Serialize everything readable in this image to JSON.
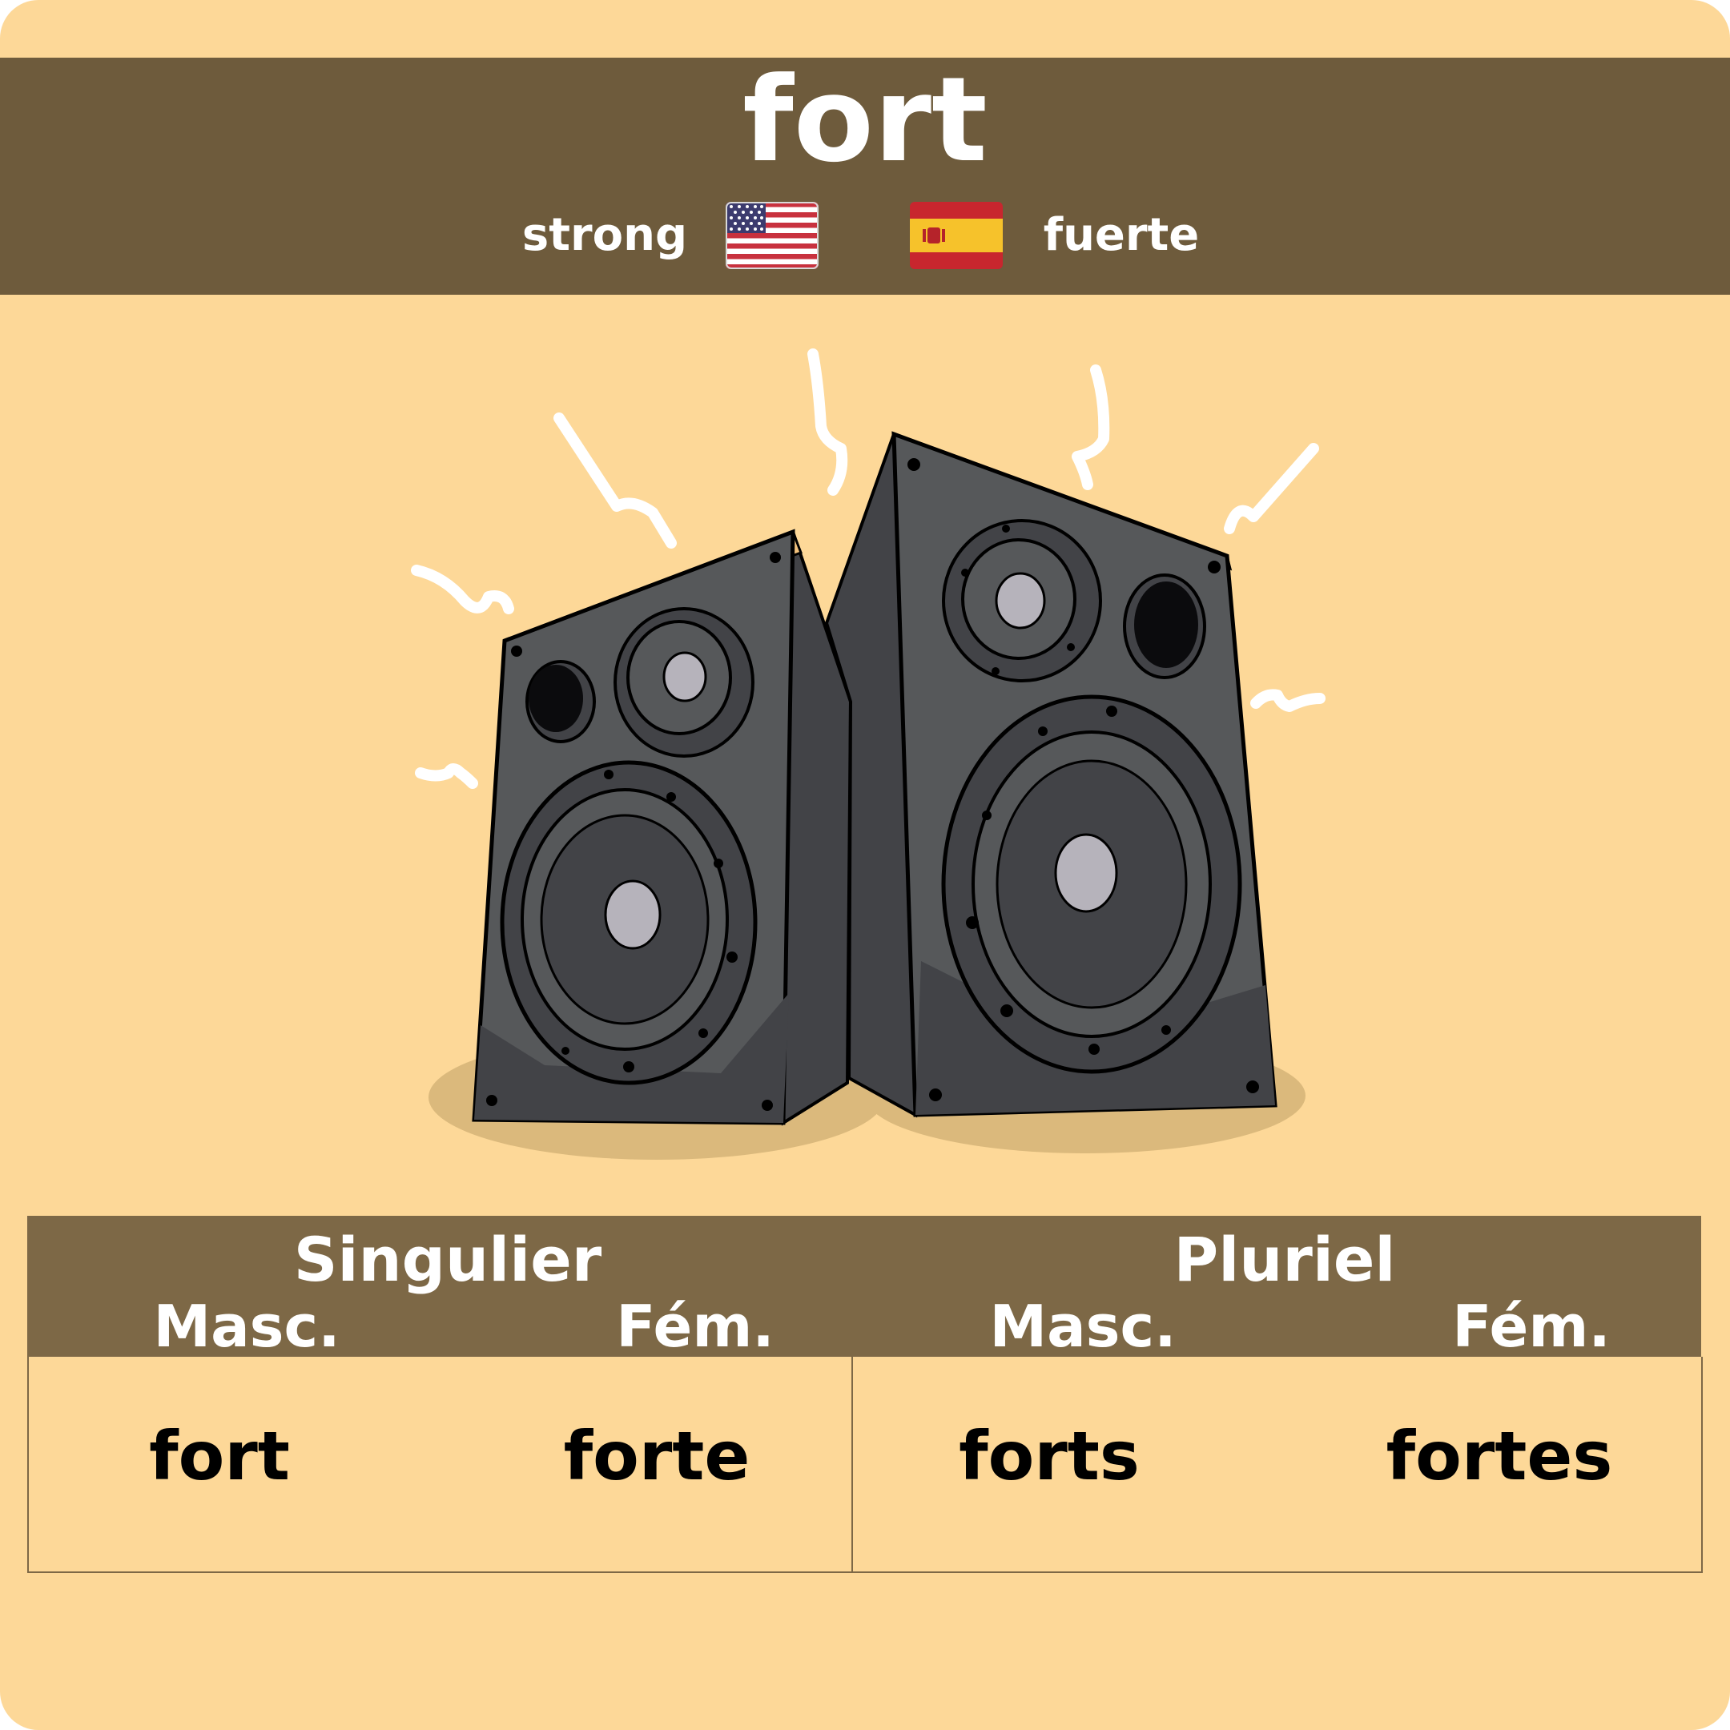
{
  "word": "fort",
  "translations": {
    "en": {
      "text": "strong",
      "flag": "us-flag-icon"
    },
    "es": {
      "text": "fuerte",
      "flag": "spain-flag-icon"
    }
  },
  "illustration": "speakers-illustration",
  "table": {
    "groups": [
      "Singulier",
      "Pluriel"
    ],
    "subheaders": [
      "Masc.",
      "Fém.",
      "Masc.",
      "Fém."
    ],
    "forms": [
      "fort",
      "forte",
      "forts",
      "fortes"
    ]
  },
  "colors": {
    "background": "#fdd898",
    "header": "#6e5b3c",
    "table_header": "#7d6846",
    "text_light": "#ffffff",
    "text_dark": "#000000"
  }
}
